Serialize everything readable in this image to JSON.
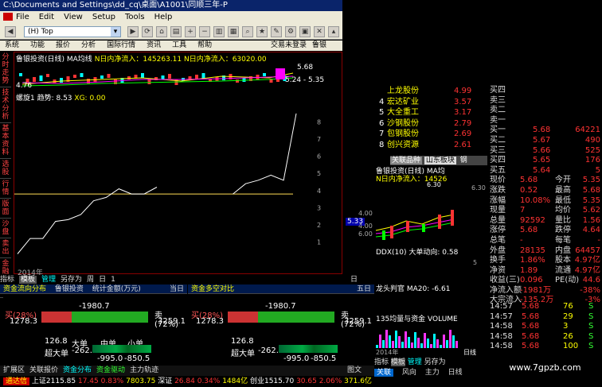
{
  "window": {
    "title": "C:\\Documents and Settings\\dd_cq\\桌面\\A1001\\同顺三年-P"
  },
  "menu": [
    "File",
    "Edit",
    "View",
    "Setup",
    "Tools",
    "Help"
  ],
  "toolbar": {
    "combo_value": "(H) Top"
  },
  "appmenu": [
    "系统",
    "功能",
    "报价",
    "分析",
    "国际行情",
    "资讯",
    "工具",
    "帮助"
  ],
  "appmenu_right": [
    "交易未登录",
    "鲁银投资"
  ],
  "sidetabs": [
    "分时走势",
    "技术分析",
    "基本资料",
    "选股",
    "行情",
    "版面",
    "沙盘",
    "卖出",
    "金融",
    "买入"
  ],
  "chart": {
    "header": "鲁银投资(日线) MA均线",
    "flow_in": "N日内净流入：145263.11",
    "flow_in2": "N日内净流入：63020.00",
    "price_high": "5.68",
    "price_range": "5.24 - 5.35",
    "price_low": "4.76",
    "indicator": "螺旋1 趋势: 8.53",
    "xg": "XG: 0.00",
    "year": "2014年",
    "right_tag": "日线"
  },
  "chart_data": {
    "type": "line",
    "title": "螺旋1 趋势",
    "series": [
      {
        "name": "趋势",
        "values": [
          0.3,
          1.2,
          1.2,
          2.2,
          2.3,
          2.6,
          3.4,
          3.6,
          4.1,
          3.8,
          3.8,
          4.2,
          null,
          null,
          null,
          null,
          null,
          3.8,
          4.4,
          4.6,
          4.9,
          4.6,
          8.5
        ]
      }
    ],
    "ylim": [
      0,
      9
    ],
    "yticks": [
      1,
      2,
      3,
      4,
      5,
      6,
      7,
      8
    ],
    "reference_line": 3.8
  },
  "subtabs": [
    "指标",
    "模板",
    "管理",
    "另存为",
    "周",
    "日",
    "1"
  ],
  "flow": {
    "left_title": "资金流向分布",
    "stock": "鲁银投资",
    "stat": "统计金额(万元)",
    "day": "当日",
    "right_title": "资金多空对比",
    "five_day": "五日",
    "net": "-1980.7",
    "buy_label": "买(28%)",
    "buy_val": "1278.3",
    "sell_label": "卖(72%)",
    "sell_val": "3259.1",
    "super": "超大单",
    "super_val": "126.8",
    "big": "大单",
    "big_val": "-262.0",
    "mid": "中单",
    "mid_val": "-995.0",
    "small": "小单",
    "small_val": "-850.5",
    "buy_pct": 28
  },
  "bottom_tabs": [
    "扩展区",
    "关联报价",
    "资金分布",
    "资金驱动",
    "主力轨迹",
    "图文F10"
  ],
  "index_bar": {
    "name": "通达信",
    "sh": "上证2115.85",
    "chg1": "17.45",
    "pct1": "0.83%",
    "amt1": "7803.75",
    "sz": "深证",
    "v2": "26.84",
    "p2": "0.34%",
    "a2": "1484亿",
    "cy": "创业1515.70",
    "v3": "30.65",
    "p3": "2.06%",
    "a3": "371.6亿"
  },
  "rank": [
    {
      "n": "",
      "name": "上龙股份",
      "v": "4.99"
    },
    {
      "n": "4",
      "name": "宏达矿业",
      "v": "3.57"
    },
    {
      "n": "5",
      "name": "大全重工",
      "v": "3.17"
    },
    {
      "n": "6",
      "name": "沙钢股份",
      "v": "2.79"
    },
    {
      "n": "7",
      "name": "包钢股份",
      "v": "2.69"
    },
    {
      "n": "8",
      "name": "创兴资源",
      "v": "2.61"
    }
  ],
  "mid_tabs": [
    "关联品种",
    "山东板块",
    "钢"
  ],
  "mini_chart": {
    "header": "鲁银投资(日线) MA均",
    "flow": "N日内净流入：14526",
    "p1": "6.30",
    "p2": "5.33",
    "p3": "4.00",
    "p4": "2.00",
    "p5": "4.00",
    "p6": "6.00",
    "ddx": "DDX(10) 大单动向: 0.58",
    "ddx_v": "5",
    "lhw": "龙头判官 MA20: -6.61",
    "vol": "135均量与资金 VOLUME",
    "year": "2014年",
    "right_tag": "日线",
    "right_p": "6.30",
    "tabs": [
      "指标",
      "模板",
      "管理",
      "另存为"
    ],
    "btabs": [
      "关联",
      "风向",
      "主力",
      "日线"
    ]
  },
  "quotes": [
    {
      "l": "买四",
      "p": "",
      "v": ""
    },
    {
      "l": "卖三",
      "p": "",
      "v": ""
    },
    {
      "l": "卖二",
      "p": "",
      "v": ""
    },
    {
      "l": "卖一",
      "p": "",
      "v": ""
    },
    {
      "l": "买一",
      "p": "5.68",
      "v": "64221"
    },
    {
      "l": "买二",
      "p": "5.67",
      "v": "490"
    },
    {
      "l": "买三",
      "p": "5.66",
      "v": "525"
    },
    {
      "l": "买四",
      "p": "5.65",
      "v": "176"
    },
    {
      "l": "买五",
      "p": "5.64",
      "v": "5"
    },
    {
      "l": "现价",
      "p": "5.68",
      "l2": "今开",
      "v": "5.35"
    },
    {
      "l": "涨跌",
      "p": "0.52",
      "l2": "最高",
      "v": "5.68"
    },
    {
      "l": "涨幅",
      "p": "10.08%",
      "l2": "最低",
      "v": "5.35"
    },
    {
      "l": "现量",
      "p": "7",
      "l2": "均价",
      "v": "5.62"
    },
    {
      "l": "总量",
      "p": "92592",
      "l2": "量比",
      "v": "1.56"
    },
    {
      "l": "涨停",
      "p": "5.68",
      "l2": "跌停",
      "v": "4.64"
    },
    {
      "l": "总笔",
      "p": "-",
      "l2": "每笔",
      "v": "-"
    },
    {
      "l": "外盘",
      "p": "28135",
      "l2": "内盘",
      "v": "64457"
    },
    {
      "l": "换手",
      "p": "1.86%",
      "l2": "股本",
      "v": "4.97亿"
    },
    {
      "l": "净资",
      "p": "1.89",
      "l2": "流通",
      "v": "4.97亿"
    },
    {
      "l": "收益(三)",
      "p": "0.096",
      "l2": "PE(动)",
      "v": "44.6"
    },
    {
      "l": "净流入额",
      "p": "-1981万",
      "l2": "",
      "v": "-38%"
    },
    {
      "l": "大宗流入",
      "p": "-135.2万",
      "l2": "",
      "v": "-3%"
    }
  ],
  "ticks": [
    {
      "t": "14:57",
      "p": "5.68",
      "v": "76",
      "s": "S"
    },
    {
      "t": "14:57",
      "p": "5.68",
      "v": "29",
      "s": "S"
    },
    {
      "t": "14:58",
      "p": "5.68",
      "v": "3",
      "s": "S"
    },
    {
      "t": "14:58",
      "p": "5.68",
      "v": "26",
      "s": "S"
    },
    {
      "t": "14:58",
      "p": "5.68",
      "v": "100",
      "s": "S"
    }
  ],
  "watermark": "www.7gpzb.com"
}
